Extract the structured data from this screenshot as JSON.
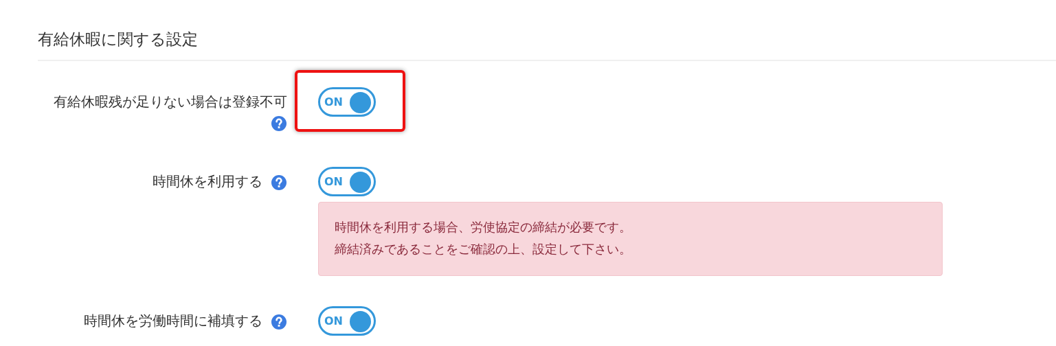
{
  "section": {
    "title": "有給休暇に関する設定"
  },
  "settings": [
    {
      "label": "有給休暇残が足りない場合は登録不可",
      "toggle_label": "ON",
      "on": true,
      "highlighted": true
    },
    {
      "label": "時間休を利用する",
      "toggle_label": "ON",
      "on": true,
      "highlighted": false,
      "alert": [
        "時間休を利用する場合、労使協定の締結が必要です。",
        "締結済みであることをご確認の上、設定して下さい。"
      ]
    },
    {
      "label": "時間休を労働時間に補填する",
      "toggle_label": "ON",
      "on": true,
      "highlighted": false
    }
  ]
}
